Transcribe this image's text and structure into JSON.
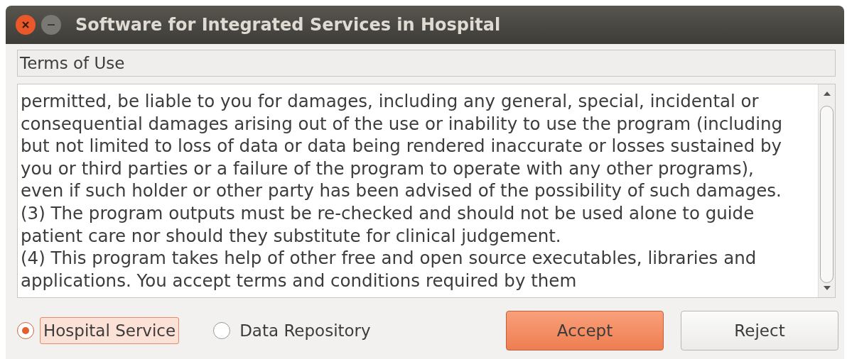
{
  "window": {
    "title": "Software for Integrated Services in Hospital"
  },
  "header": {
    "label": "Terms of Use"
  },
  "terms_lines": [
    "permitted, be liable to you for damages, including any general, special, incidental or",
    "consequential damages arising out of the use or inability to use the program (including",
    "but not limited to loss of data or data being rendered inaccurate or losses sustained by",
    "you or third parties or a failure of the program to operate with any other programs),",
    "even if such holder or other party has been advised of the possibility of such damages.",
    "(3) The program outputs must be re-checked and should not be used alone to guide",
    "patient care nor should they substitute for clinical judgement.",
    "(4) This program takes help of other free and open source executables, libraries and",
    "applications. You accept terms and conditions required by them"
  ],
  "modes": [
    {
      "label": "Hospital Service",
      "selected": true,
      "focused": true
    },
    {
      "label": "Data Repository",
      "selected": false,
      "focused": false
    }
  ],
  "buttons": [
    {
      "label": "Accept",
      "primary": true
    },
    {
      "label": "Reject",
      "primary": false
    }
  ]
}
